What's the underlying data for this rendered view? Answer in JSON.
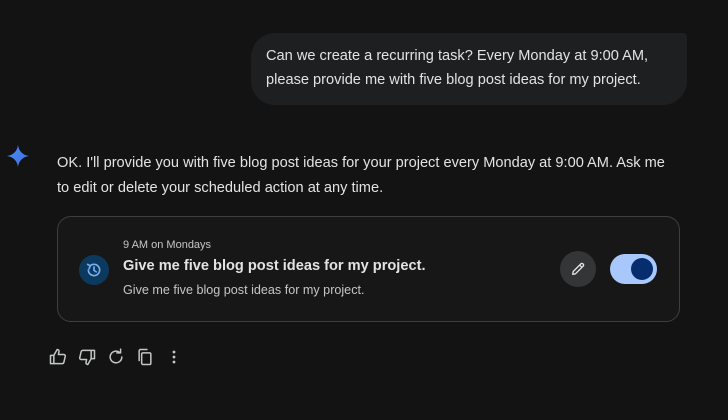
{
  "conversation": {
    "user_message": {
      "line1": "Can we create a recurring task? Every Monday at 9:00 AM,",
      "line2": "please provide me with five blog post ideas for my project."
    },
    "assistant_response": {
      "line1": "OK. I'll provide you with five blog post ideas for your project every Monday at 9:00 AM. Ask me",
      "line2": "to edit or delete your scheduled action at any time."
    },
    "scheduled_action": {
      "schedule": "9 AM on Mondays",
      "title": "Give me five blog post ideas for my project.",
      "description": "Give me five blog post ideas for my project.",
      "enabled": true,
      "icon": "schedule-history-icon"
    },
    "response_actions": [
      {
        "icon": "thumbs-up-icon"
      },
      {
        "icon": "thumbs-down-icon"
      },
      {
        "icon": "regenerate-icon"
      },
      {
        "icon": "copy-icon"
      },
      {
        "icon": "more-vert-icon"
      }
    ]
  },
  "colors": {
    "background": "#131314",
    "user_bubble": "#1e1f20",
    "text": "#e3e3e3",
    "secondary_text": "#c4c7c5",
    "toggle_track": "#a8c7fa",
    "toggle_knob": "#062e6f",
    "sparkle": "#4285f4"
  }
}
